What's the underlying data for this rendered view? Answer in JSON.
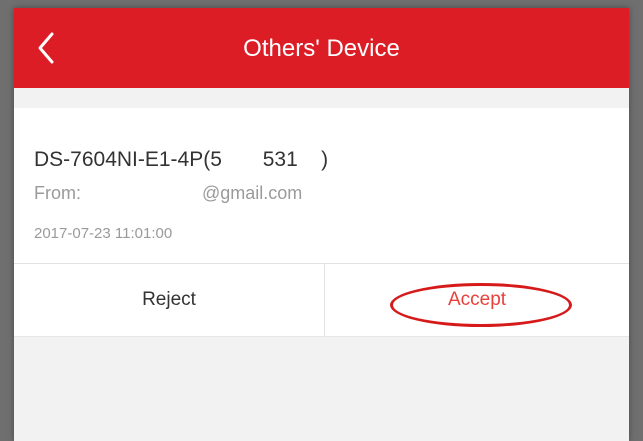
{
  "header": {
    "title": "Others' Device",
    "back_icon": "chevron-left-icon"
  },
  "share_request": {
    "device_name": "DS-7604NI-E1-4P(5       531    )",
    "from_label": "From:",
    "from_email": "@gmail.com",
    "timestamp": "2017-07-23 11:01:00"
  },
  "actions": {
    "reject_label": "Reject",
    "accept_label": "Accept"
  },
  "colors": {
    "header_bg": "#dd1d26",
    "accept_text": "#e8413b",
    "annotation": "#d61a1a"
  }
}
